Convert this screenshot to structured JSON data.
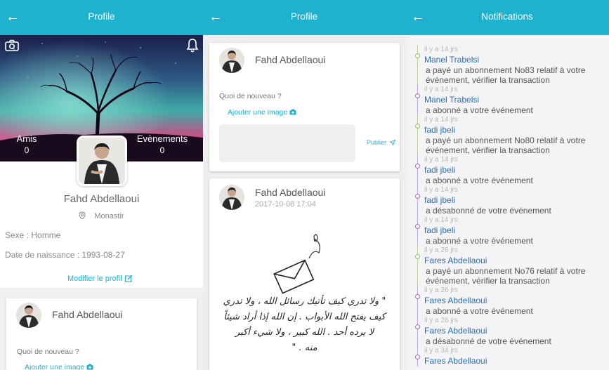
{
  "panel1": {
    "back_icon": "←",
    "title": "Profile",
    "stats": [
      {
        "label": "Amis",
        "value": "0"
      },
      {
        "label": "Evènements",
        "value": "0"
      }
    ],
    "name": "Fahd Abdellaoui",
    "location": "Monastir",
    "sexe": "Sexe : Homme",
    "birth": "Date de naissance : 1993-08-27",
    "edit_label": "Modifier le profil",
    "post_card": {
      "name": "Fahd Abdellaoui",
      "prompt": "Quoi de nouveau ?",
      "add_image": "Ajouter une image"
    }
  },
  "panel2": {
    "back_icon": "←",
    "title": "Profile",
    "composer": {
      "name": "Fahd Abdellaoui",
      "prompt": "Quoi de nouveau ?",
      "add_image": "Ajouter une image",
      "publish_label": "Publier"
    },
    "post": {
      "name": "Fahd Abdellaoui",
      "date": "2017-10-08 17:04",
      "image_lines": [
        "\" ولا تدري كيف تأتيك رسائل الله ، ولا تدري",
        "كيف يفتح الله الأبواب . إن الله إذا أراد شيئاً",
        "لا يرده أحد . الله كبير ، ولا شيء أكبر",
        "منه . \""
      ]
    }
  },
  "panel3": {
    "back_icon": "←",
    "title": "Notifications",
    "items": [
      {
        "time": "il y a 14 jrs",
        "name": "Manel Trabelsi",
        "text": [
          "a payé un abonnement No83 relatif à votre",
          "événement, vérifier la transaction"
        ],
        "color": "#8bc34a"
      },
      {
        "time": "il y a 14 jrs",
        "name": "Manel Trabelsi",
        "text": [
          "a abonné a votre événement"
        ],
        "color": "#9c6ad6"
      },
      {
        "time": "il y a 14 jrs",
        "name": "fadi jbeli",
        "text": [
          "a payé un abonnement No80 relatif à votre",
          "événement, vérifier la transaction"
        ],
        "color": "#8bc34a"
      },
      {
        "time": "il y a 14 jrs",
        "name": "fadi jbeli",
        "text": [
          "a abonné a votre événement"
        ],
        "color": "#9c6ad6"
      },
      {
        "time": "il y a 14 jrs",
        "name": "fadi jbeli",
        "text": [
          "a désabonné de votre événement"
        ],
        "color": "#9c6ad6"
      },
      {
        "time": "il y a 14 jrs",
        "name": "fadi jbeli",
        "text": [
          "a abonné a votre événement"
        ],
        "color": "#9c6ad6"
      },
      {
        "time": "il y a 26 jrs",
        "name": "Fares Abdellaoui",
        "text": [
          "a payé un abonnement No76 relatif à votre",
          "événement, vérifier la transaction"
        ],
        "color": "#8bc34a"
      },
      {
        "time": "il y a 26 jrs",
        "name": "Fares Abdellaoui",
        "text": [
          "a abonné a votre événement"
        ],
        "color": "#9c6ad6"
      },
      {
        "time": "il y a 26 jrs",
        "name": "Fares Abdellaoui",
        "text": [
          "a désabonné de votre événement"
        ],
        "color": "#9c6ad6"
      },
      {
        "time": "il y a 34 jrs",
        "name": "Fares Abdellaoui",
        "text": [],
        "color": "#9c6ad6"
      }
    ]
  },
  "colors": {
    "accent": "#1eb2cf",
    "link_name": "#2c6eb5",
    "payment": "#8bc34a",
    "subscription": "#9c6ad6"
  },
  "icons": [
    "back-arrow-icon",
    "camera-icon",
    "bell-icon",
    "location-pin-icon",
    "edit-icon",
    "send-icon"
  ]
}
